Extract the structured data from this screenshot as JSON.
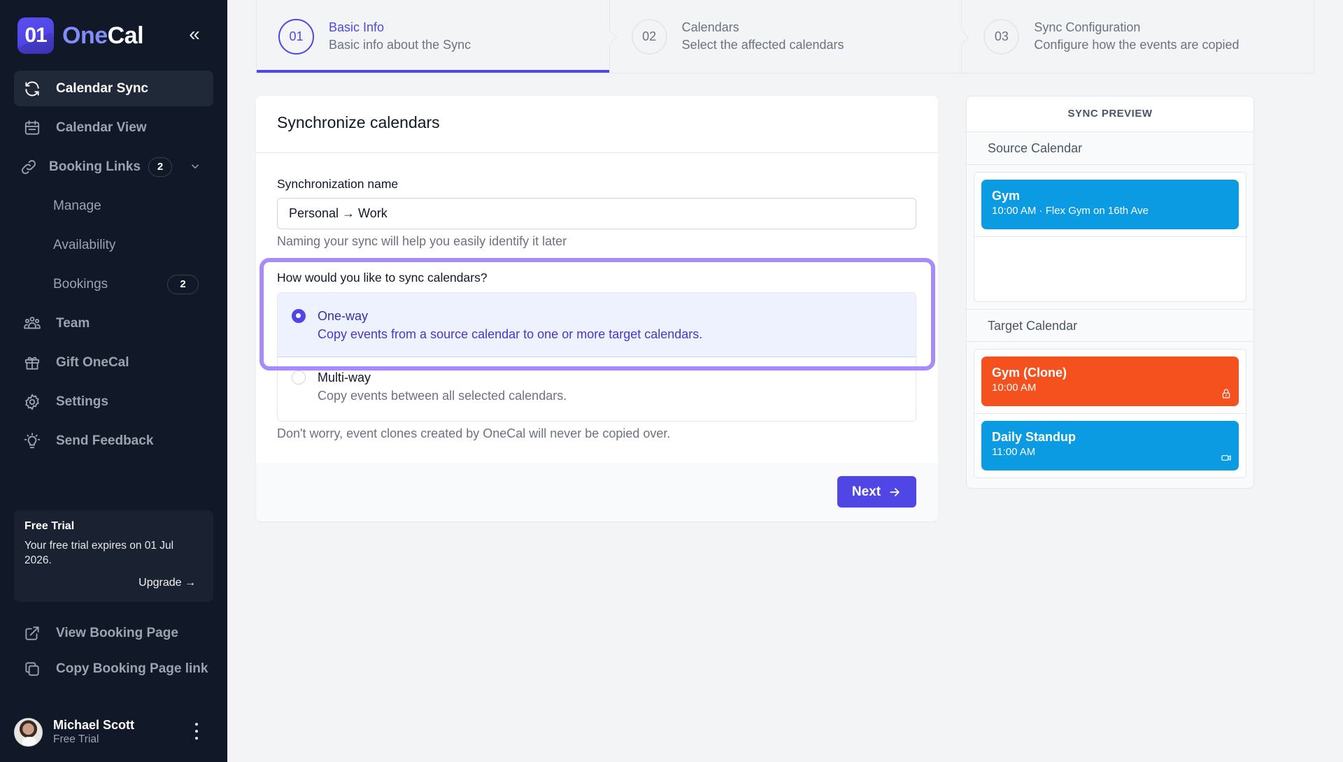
{
  "brand": {
    "logo_text": "01",
    "name_part1": "One",
    "name_part2": "Cal",
    "collapse_label": "«"
  },
  "sidebar": {
    "items": [
      {
        "label": "Calendar Sync",
        "icon": "sync-icon",
        "active": true
      },
      {
        "label": "Calendar View",
        "icon": "calendar-icon"
      },
      {
        "label": "Booking Links",
        "icon": "link-icon",
        "badge": "2",
        "expanded": true
      },
      {
        "label": "Manage",
        "sub": true
      },
      {
        "label": "Availability",
        "sub": true
      },
      {
        "label": "Bookings",
        "sub": true,
        "badge": "2"
      },
      {
        "label": "Team",
        "icon": "team-icon"
      },
      {
        "label": "Gift OneCal",
        "icon": "gift-icon"
      },
      {
        "label": "Settings",
        "icon": "gear-icon"
      },
      {
        "label": "Send Feedback",
        "icon": "lightbulb-icon"
      }
    ],
    "trial": {
      "title": "Free Trial",
      "text": "Your free trial expires on 01 Jul 2026.",
      "upgrade_label": "Upgrade →"
    },
    "footer_links": [
      {
        "label": "View Booking Page",
        "icon": "external-link-icon"
      },
      {
        "label": "Copy Booking Page link",
        "icon": "copy-icon"
      }
    ],
    "user": {
      "name": "Michael Scott",
      "plan": "Free Trial"
    }
  },
  "stepper": {
    "steps": [
      {
        "number": "01",
        "title": "Basic Info",
        "description": "Basic info about the Sync",
        "active": true
      },
      {
        "number": "02",
        "title": "Calendars",
        "description": "Select the affected calendars"
      },
      {
        "number": "03",
        "title": "Sync Configuration",
        "description": "Configure how the events are copied"
      }
    ]
  },
  "form": {
    "title": "Synchronize calendars",
    "name_label": "Synchronization name",
    "name_value": "Personal → Work",
    "name_help": "Naming your sync will help you easily identify it later",
    "sync_question": "How would you like to sync calendars?",
    "options": [
      {
        "title": "One-way",
        "description": "Copy events from a source calendar to one or more target calendars.",
        "selected": true
      },
      {
        "title": "Multi-way",
        "description": "Copy events between all selected calendars.",
        "selected": false
      }
    ],
    "clone_note": "Don't worry, event clones created by OneCal will never be copied over.",
    "next_label": "Next"
  },
  "preview": {
    "title": "SYNC PREVIEW",
    "source_label": "Source Calendar",
    "target_label": "Target Calendar",
    "source_events": [
      {
        "title": "Gym",
        "subtitle": "10:00 AM · Flex Gym on 16th Ave",
        "color": "#0b9be3"
      }
    ],
    "target_events": [
      {
        "title": "Gym (Clone)",
        "subtitle": "10:00 AM",
        "color": "#f4511e",
        "icon": "lock-icon"
      },
      {
        "title": "Daily Standup",
        "subtitle": "11:00 AM",
        "color": "#0b9be3",
        "icon": "video-icon"
      }
    ]
  },
  "colors": {
    "accent": "#4f46e5",
    "sidebar_bg": "#111827",
    "highlight": "#a78bfa"
  }
}
